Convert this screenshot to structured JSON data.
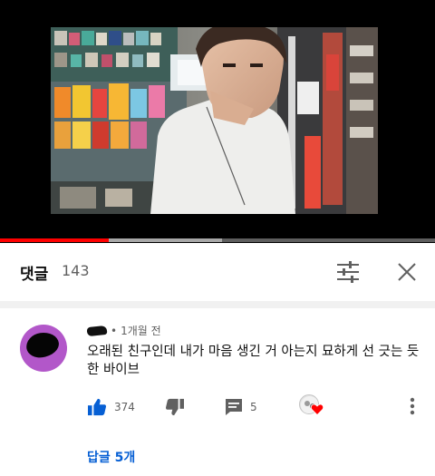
{
  "player": {
    "progress_played": 0.25,
    "progress_buffered": 0.51,
    "colors": {
      "played": "#ff0000",
      "buffered": "#a8a8a8",
      "track": "#5e5e5e"
    }
  },
  "comments_header": {
    "title": "댓글",
    "count": "143",
    "icons": {
      "sort": "sliders-icon",
      "close": "close-icon"
    }
  },
  "comment": {
    "time_ago": "1개월 전",
    "text": "오래된 친구인데 내가 마음 생긴 거 아는지 묘하게 선 긋는 듯한 바이브",
    "likes": "374",
    "replies_count": "5",
    "icons": {
      "like": "thumbs-up-icon",
      "dislike": "thumbs-down-icon",
      "reply": "reply-comment-icon",
      "creator_heart": "creator-heart-icon",
      "more": "more-vertical-icon"
    },
    "colors": {
      "like_active": "#065fd4",
      "heart": "#ff0000",
      "avatar_bg": "#b257c9"
    }
  },
  "replies_link": "답글 5개"
}
